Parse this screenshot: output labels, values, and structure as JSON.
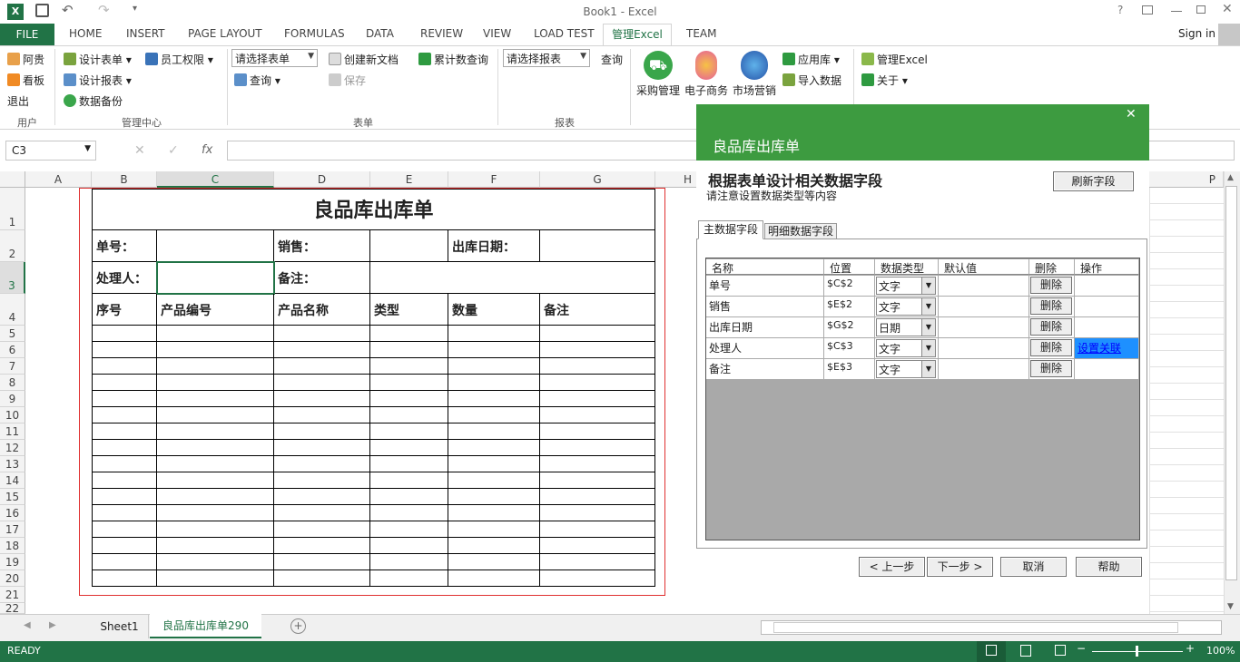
{
  "window": {
    "title": "Book1 - Excel",
    "sign_in": "Sign in",
    "help": "?"
  },
  "tabs": [
    "FILE",
    "HOME",
    "INSERT",
    "PAGE LAYOUT",
    "FORMULAS",
    "DATA",
    "REVIEW",
    "VIEW",
    "LOAD TEST",
    "管理Excel",
    "TEAM"
  ],
  "ribbon": {
    "user_group": {
      "label": "用户",
      "items": [
        "阿贵",
        "看板",
        "退出"
      ]
    },
    "manage_group": {
      "label": "管理中心",
      "items": [
        "设计表单",
        "员工权限",
        "设计报表",
        "数据备份"
      ]
    },
    "form_group": {
      "label": "表单",
      "select": "请选择表单",
      "query": "查询",
      "create": "创建新文档",
      "save": "保存",
      "total": "累计数查询"
    },
    "report_group": {
      "label": "报表",
      "select": "请选择报表",
      "query": "查询"
    },
    "big_buttons": [
      "采购管理",
      "电子商务",
      "市场营销"
    ],
    "app_items": [
      "应用库",
      "导入数据"
    ],
    "about_items": [
      "管理Excel",
      "关于"
    ]
  },
  "formula_bar": {
    "name_box": "C3",
    "fx": "fx"
  },
  "columns": [
    "A",
    "B",
    "C",
    "D",
    "E",
    "F",
    "G",
    "H",
    "P"
  ],
  "rows": [
    "1",
    "2",
    "3",
    "4",
    "5",
    "6",
    "7",
    "8",
    "9",
    "10",
    "11",
    "12",
    "13",
    "14",
    "15",
    "16",
    "17",
    "18",
    "19",
    "20",
    "21",
    "22"
  ],
  "sheet": {
    "title": "良品库出库单",
    "labels": {
      "no": "单号：",
      "sales": "销售：",
      "date": "出库日期：",
      "handler": "处理人：",
      "remark": "备注："
    },
    "headers": [
      "序号",
      "产品编号",
      "产品名称",
      "类型",
      "数量",
      "备注"
    ]
  },
  "dialog": {
    "title": "良品库出库单",
    "heading": "根据表单设计相关数据字段",
    "subheading": "请注意设置数据类型等内容",
    "refresh": "刷新字段",
    "tabs": [
      "主数据字段",
      "明细数据字段"
    ],
    "columns": [
      "名称",
      "位置",
      "数据类型",
      "默认值",
      "删除",
      "操作"
    ],
    "rows": [
      {
        "name": "单号",
        "pos": "$C$2",
        "type": "文字",
        "del": "删除",
        "op": ""
      },
      {
        "name": "销售",
        "pos": "$E$2",
        "type": "文字",
        "del": "删除",
        "op": ""
      },
      {
        "name": "出库日期",
        "pos": "$G$2",
        "type": "日期",
        "del": "删除",
        "op": ""
      },
      {
        "name": "处理人",
        "pos": "$C$3",
        "type": "文字",
        "del": "删除",
        "op": "设置关联"
      },
      {
        "name": "备注",
        "pos": "$E$3",
        "type": "文字",
        "del": "删除",
        "op": ""
      }
    ],
    "buttons": {
      "prev": "< 上一步",
      "next": "下一步 >",
      "cancel": "取消",
      "help": "帮助"
    }
  },
  "sheet_tabs": [
    "Sheet1",
    "良品库出库单290"
  ],
  "status": {
    "ready": "READY",
    "zoom": "100%"
  },
  "colors": {
    "accent": "#217346",
    "dialog_title": "#3d9b40",
    "selection": "#1e90ff"
  }
}
